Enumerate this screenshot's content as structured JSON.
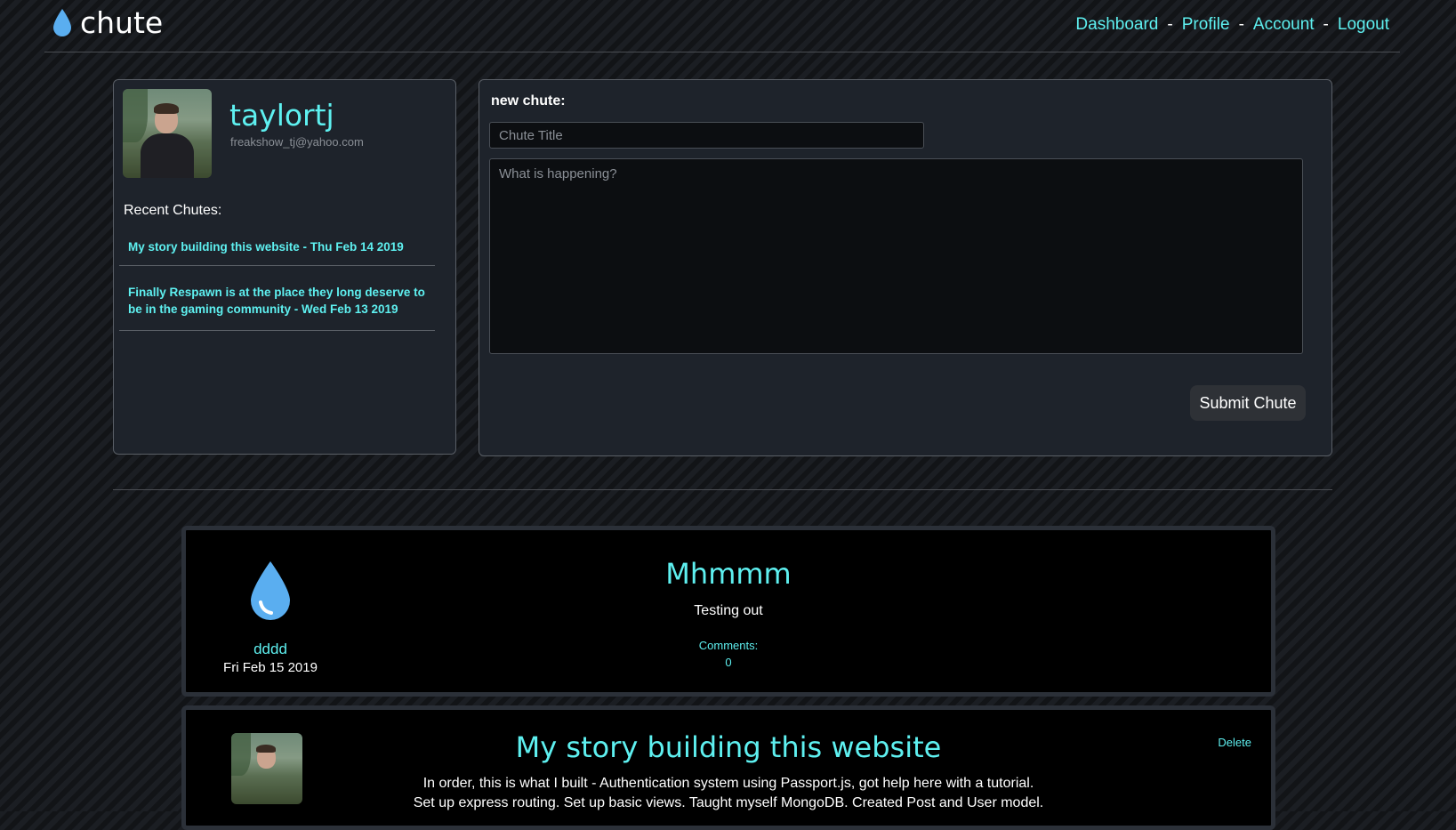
{
  "header": {
    "brand": "chute",
    "nav": [
      {
        "label": "Dashboard"
      },
      {
        "label": "Profile"
      },
      {
        "label": "Account"
      },
      {
        "label": "Logout"
      }
    ],
    "separator": "-"
  },
  "profile": {
    "username": "taylortj",
    "email": "freakshow_tj@yahoo.com",
    "recent_heading": "Recent Chutes:",
    "recent": [
      {
        "text": "My story building this website - Thu Feb 14 2019"
      },
      {
        "text": "Finally Respawn is at the place they long deserve to be in the gaming community - Wed Feb 13 2019"
      }
    ]
  },
  "new_chute": {
    "label": "new chute:",
    "title_placeholder": "Chute Title",
    "body_placeholder": "What is happening?",
    "submit_label": "Submit Chute"
  },
  "posts": [
    {
      "author": "dddd",
      "date": "Fri Feb 15 2019",
      "title": "Mhmmm",
      "body": "Testing out",
      "comments_label": "Comments:",
      "comments_count": "0"
    },
    {
      "title": "My story building this website",
      "delete_label": "Delete",
      "body_line1": "In order, this is what I built - Authentication system using Passport.js, got help here with a tutorial.",
      "body_line2": "Set up express routing. Set up basic views. Taught myself MongoDB. Created Post and User model."
    }
  ],
  "colors": {
    "accent": "#5ef0f0",
    "drop": "#5aaef0",
    "card_bg": "#1e232b"
  }
}
